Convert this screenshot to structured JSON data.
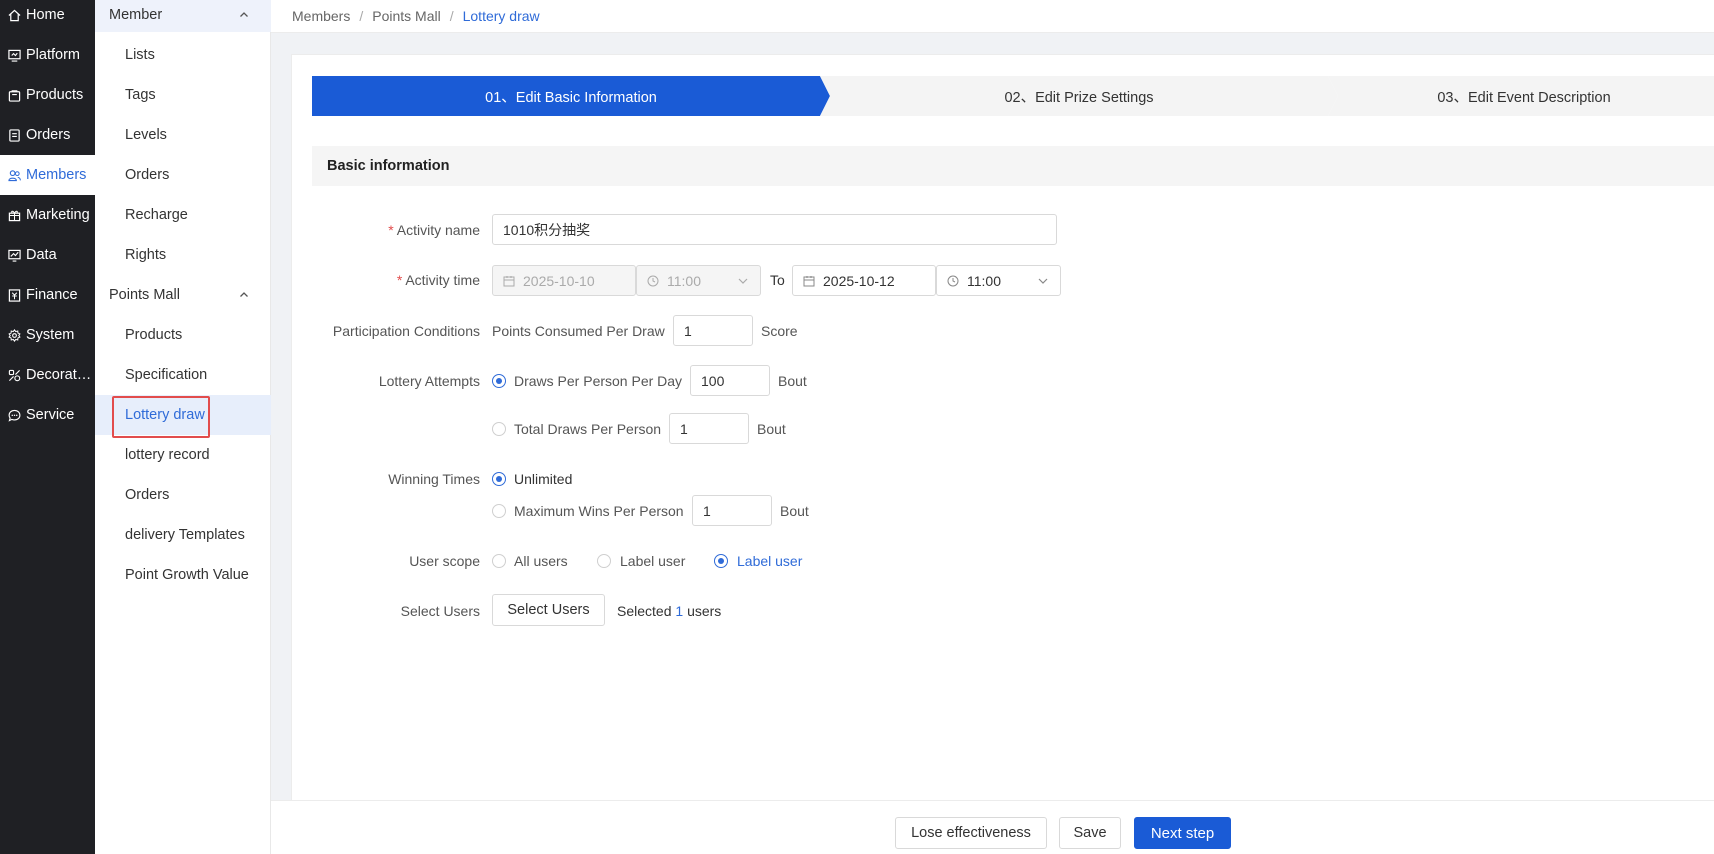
{
  "nav_primary": [
    {
      "label": "Home",
      "icon": "home-icon"
    },
    {
      "label": "Platform",
      "icon": "monitor-icon"
    },
    {
      "label": "Products",
      "icon": "bag-icon"
    },
    {
      "label": "Orders",
      "icon": "document-icon"
    },
    {
      "label": "Members",
      "icon": "users-icon"
    },
    {
      "label": "Marketing",
      "icon": "gift-icon"
    },
    {
      "label": "Data",
      "icon": "chart-icon"
    },
    {
      "label": "Finance",
      "icon": "finance-icon"
    },
    {
      "label": "System",
      "icon": "gear-icon"
    },
    {
      "label": "Decorat…",
      "icon": "decoration-icon"
    },
    {
      "label": "Service",
      "icon": "chat-icon"
    }
  ],
  "nav_secondary": {
    "member_group": "Member",
    "member_items": [
      "Lists",
      "Tags",
      "Levels",
      "Orders",
      "Recharge",
      "Rights"
    ],
    "points_group": "Points Mall",
    "points_items": [
      "Products",
      "Specification",
      "Lottery draw",
      "lottery record",
      "Orders",
      "delivery Templates",
      "Point Growth Value"
    ]
  },
  "breadcrumb": [
    "Members",
    "Points Mall",
    "Lottery draw"
  ],
  "steps": [
    "01、Edit Basic Information",
    "02、Edit Prize Settings",
    "03、Edit Event Description"
  ],
  "section_title": "Basic information",
  "form": {
    "activity_name_label": "Activity name",
    "activity_name_value": "1010积分抽奖",
    "activity_time_label": "Activity time",
    "start_date": "2025-10-10",
    "start_time": "11:00",
    "to_label": "To",
    "end_date": "2025-10-12",
    "end_time": "11:00",
    "participation_label": "Participation Conditions",
    "points_per_draw_label": "Points Consumed Per Draw",
    "points_per_draw_value": "1",
    "points_unit": "Score",
    "attempts_label": "Lottery Attempts",
    "per_day_label": "Draws Per Person Per Day",
    "per_day_value": "100",
    "per_day_unit": "Bout",
    "total_label": "Total Draws Per Person",
    "total_value": "1",
    "total_unit": "Bout",
    "winning_label": "Winning Times",
    "unlimited_label": "Unlimited",
    "max_wins_label": "Maximum Wins Per Person",
    "max_wins_value": "1",
    "max_wins_unit": "Bout",
    "user_scope_label": "User scope",
    "scope_all": "All users",
    "scope_label1": "Label user",
    "scope_label2": "Label user",
    "select_users_label": "Select Users",
    "select_users_button": "Select Users",
    "selected_prefix": "Selected",
    "selected_count": "1",
    "selected_suffix": "users"
  },
  "footer": {
    "lose_label": "Lose effectiveness",
    "save_label": "Save",
    "next_label": "Next step"
  },
  "colors": {
    "accent": "#1a5bd6",
    "sidebar_bg": "#1f2024",
    "highlight_border": "#e24c4c"
  }
}
